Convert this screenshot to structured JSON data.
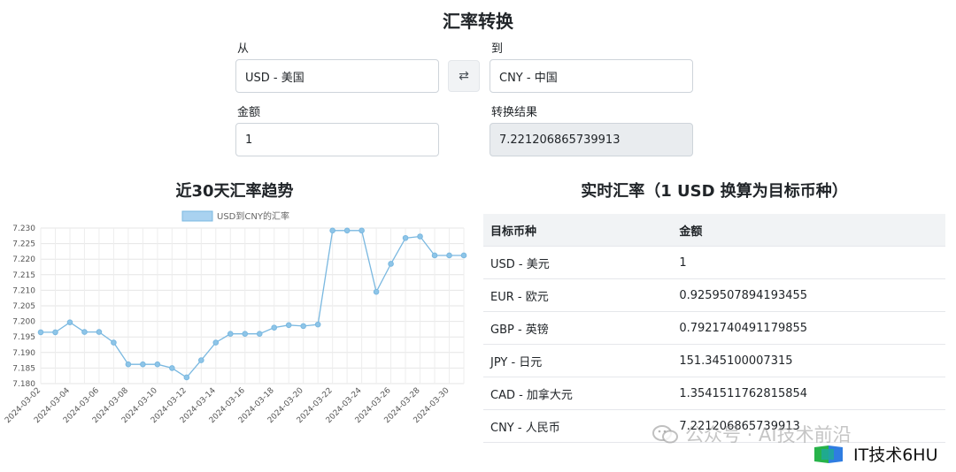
{
  "header": {
    "title": "汇率转换"
  },
  "form": {
    "from_label": "从",
    "from_value": "USD - 美国",
    "to_label": "到",
    "to_value": "CNY - 中国",
    "amount_label": "金额",
    "amount_value": "1",
    "result_label": "转换结果",
    "result_value": "7.221206865739913",
    "swap_icon": "⇄"
  },
  "trend": {
    "title": "近30天汇率趋势"
  },
  "chart_data": {
    "type": "line",
    "legend": "USD到CNY的汇率",
    "color": "#7ab8e0",
    "ylim": [
      7.18,
      7.23
    ],
    "yticks": [
      "7.230",
      "7.225",
      "7.220",
      "7.215",
      "7.210",
      "7.205",
      "7.200",
      "7.195",
      "7.190",
      "7.185",
      "7.180"
    ],
    "x": [
      "2024-03-02",
      "2024-03-03",
      "2024-03-04",
      "2024-03-05",
      "2024-03-06",
      "2024-03-07",
      "2024-03-08",
      "2024-03-09",
      "2024-03-10",
      "2024-03-11",
      "2024-03-12",
      "2024-03-13",
      "2024-03-14",
      "2024-03-15",
      "2024-03-16",
      "2024-03-17",
      "2024-03-18",
      "2024-03-19",
      "2024-03-20",
      "2024-03-21",
      "2024-03-22",
      "2024-03-23",
      "2024-03-24",
      "2024-03-25",
      "2024-03-26",
      "2024-03-27",
      "2024-03-28",
      "2024-03-29",
      "2024-03-30",
      "2024-03-31"
    ],
    "xtick_labels": [
      "2024-03-02",
      "2024-03-04",
      "2024-03-06",
      "2024-03-08",
      "2024-03-10",
      "2024-03-12",
      "2024-03-14",
      "2024-03-16",
      "2024-03-18",
      "2024-03-20",
      "2024-03-22",
      "2024-03-24",
      "2024-03-26",
      "2024-03-28",
      "2024-03-30"
    ],
    "values": [
      7.1965,
      7.1965,
      7.1997,
      7.1966,
      7.1966,
      7.1932,
      7.1862,
      7.1862,
      7.1862,
      7.185,
      7.182,
      7.1875,
      7.1932,
      7.196,
      7.196,
      7.196,
      7.198,
      7.1988,
      7.1985,
      7.199,
      7.2292,
      7.2292,
      7.2292,
      7.2095,
      7.2185,
      7.2268,
      7.2273,
      7.2212,
      7.2212,
      7.2212
    ],
    "grid": true,
    "legend_position": "top"
  },
  "rates": {
    "title": "实时汇率（1 USD 换算为目标币种）",
    "columns": [
      "目标币种",
      "金额"
    ],
    "rows": [
      [
        "USD - 美元",
        "1"
      ],
      [
        "EUR - 欧元",
        "0.9259507894193455"
      ],
      [
        "GBP - 英镑",
        "0.7921740491179855"
      ],
      [
        "JPY - 日元",
        "151.345100007315"
      ],
      [
        "CAD - 加拿大元",
        "1.3541511762815854"
      ],
      [
        "CNY - 人民币",
        "7.221206865739913"
      ]
    ]
  },
  "watermark": {
    "text": "公众号 · AI技术前沿",
    "icon": "wechat-icon"
  },
  "logo": {
    "text": "IT技术6HU",
    "icon": "it-logo-icon"
  }
}
